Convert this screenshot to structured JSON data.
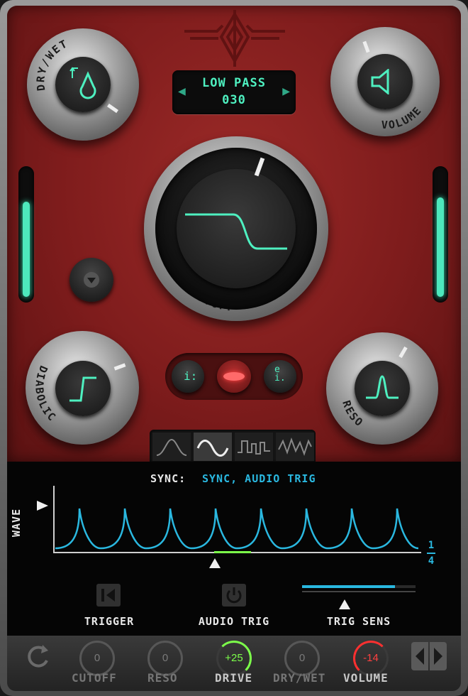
{
  "preset": {
    "line1": "LOW PASS",
    "line2": "030"
  },
  "knobs": {
    "dry_wet": "DRY/WET",
    "volume": "VOLUME",
    "cutoff": "CUTOFF",
    "diabolic": "DIABOLIC",
    "reso": "RESO"
  },
  "sync": {
    "label": "SYNC:",
    "value": "SYNC, AUDIO TRIG"
  },
  "graph": {
    "side_label": "WAVE",
    "rate_num": "1",
    "rate_den": "4"
  },
  "controls": {
    "trigger": "TRIGGER",
    "audio_trig": "AUDIO TRIG",
    "trig_sens": "TRIG SENS",
    "trig_sens_level": 0.82
  },
  "footer": {
    "items": [
      {
        "label": "CUTOFF",
        "value": "0"
      },
      {
        "label": "RESO",
        "value": "0"
      },
      {
        "label": "DRIVE",
        "value": "+25"
      },
      {
        "label": "DRY/WET",
        "value": "0"
      },
      {
        "label": "VOLUME",
        "value": "-14"
      }
    ]
  },
  "colors": {
    "teal": "#4ef0c0",
    "cyan": "#2ab8e0",
    "red_panel": "#8a2222",
    "drive_green": "#7cff4a",
    "volume_red": "#ff3030"
  },
  "icons": [
    "logo-icon",
    "dry-wet-drop-icon",
    "speaker-icon",
    "lowpass-curve-icon",
    "step-curve-icon",
    "peak-curve-icon",
    "triangle-down-icon",
    "trigger-icon",
    "power-icon",
    "reset-icon",
    "prev-icon",
    "next-icon"
  ]
}
